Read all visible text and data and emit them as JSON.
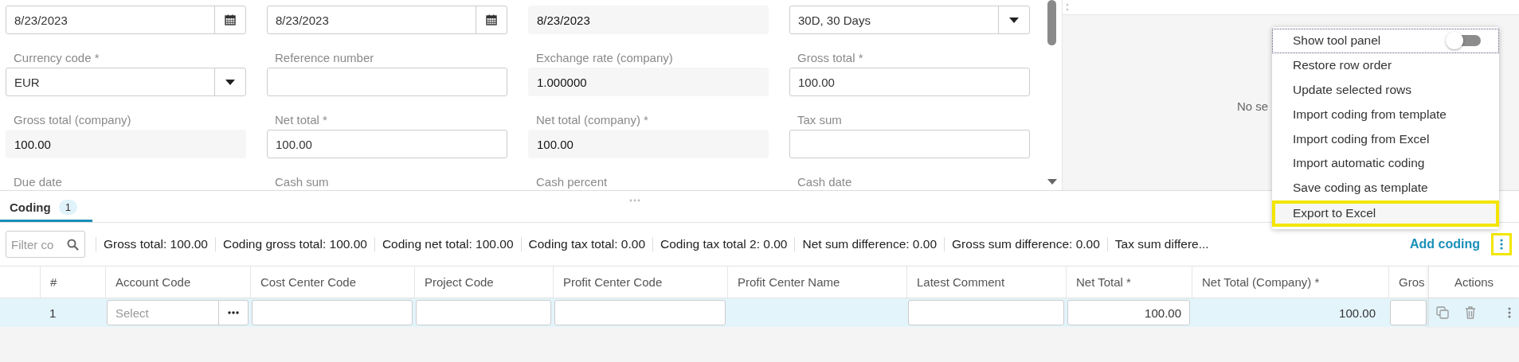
{
  "form": {
    "fields": [
      {
        "kind": "date",
        "value": "8/23/2023"
      },
      {
        "kind": "date",
        "value": "8/23/2023"
      },
      {
        "kind": "readonly",
        "value": "8/23/2023"
      },
      {
        "kind": "select",
        "value": "30D, 30 Days"
      },
      {
        "label": "Currency code *",
        "kind": "select",
        "value": "EUR"
      },
      {
        "label": "Reference number",
        "kind": "input"
      },
      {
        "label": "Exchange rate (company)",
        "kind": "readonly",
        "value": "1.000000"
      },
      {
        "label": "Gross total *",
        "kind": "input",
        "value": "100.00"
      },
      {
        "label": "Gross total (company)",
        "kind": "readonly",
        "value": "100.00"
      },
      {
        "label": "Net total *",
        "kind": "input",
        "value": "100.00"
      },
      {
        "label": "Net total (company) *",
        "kind": "readonly",
        "value": "100.00"
      },
      {
        "label": "Tax sum",
        "kind": "input"
      },
      {
        "label": "Due date",
        "kind": "none"
      },
      {
        "label": "Cash sum",
        "kind": "none"
      },
      {
        "label": "Cash percent",
        "kind": "none"
      },
      {
        "label": "Cash date",
        "kind": "none"
      }
    ]
  },
  "side_panel": {
    "message": "No se"
  },
  "menu": {
    "items": [
      {
        "label": "Show tool panel",
        "kind": "toggle",
        "on": false,
        "focused": true,
        "highlighted": false
      },
      {
        "label": "Restore row order",
        "kind": "action",
        "focused": false,
        "highlighted": false
      },
      {
        "label": "Update selected rows",
        "kind": "action",
        "focused": false,
        "highlighted": false
      },
      {
        "label": "Import coding from template",
        "kind": "action",
        "focused": false,
        "highlighted": false
      },
      {
        "label": "Import coding from Excel",
        "kind": "action",
        "focused": false,
        "highlighted": false
      },
      {
        "label": "Import automatic coding",
        "kind": "action",
        "focused": false,
        "highlighted": false
      },
      {
        "label": "Save coding as template",
        "kind": "action",
        "focused": false,
        "highlighted": false
      },
      {
        "label": "Export to Excel",
        "kind": "action",
        "focused": false,
        "highlighted": true
      }
    ]
  },
  "tabs": [
    {
      "label": "Coding",
      "badge": "1",
      "selected": true
    }
  ],
  "toolbar": {
    "filter": {
      "placeholder": "Filter co"
    },
    "totals": [
      "Gross total: 100.00",
      "Coding gross total: 100.00",
      "Coding net total: 100.00",
      "Coding tax total: 0.00",
      "Coding tax total 2: 0.00",
      "Net sum difference: 0.00",
      "Gross sum difference: 0.00",
      "Tax sum differe..."
    ],
    "add_button": "Add coding",
    "more_button": {
      "highlighted": true
    }
  },
  "table": {
    "columns": [
      "#",
      "Account Code",
      "Cost Center Code",
      "Project Code",
      "Profit Center Code",
      "Profit Center Name",
      "Latest Comment",
      "Net Total *",
      "Net Total (Company) *",
      "Gros",
      "Actions"
    ],
    "rows": [
      {
        "selected": true,
        "cells": [
          {
            "kind": "text",
            "value": "1"
          },
          {
            "kind": "lookup",
            "placeholder": "Select"
          },
          {
            "kind": "input"
          },
          {
            "kind": "input"
          },
          {
            "kind": "input"
          },
          {
            "kind": "readonly"
          },
          {
            "kind": "input"
          },
          {
            "kind": "input",
            "value": "100.00"
          },
          {
            "kind": "readonly",
            "value": "100.00"
          },
          {
            "kind": "input"
          },
          {
            "kind": "actions"
          }
        ]
      }
    ]
  }
}
